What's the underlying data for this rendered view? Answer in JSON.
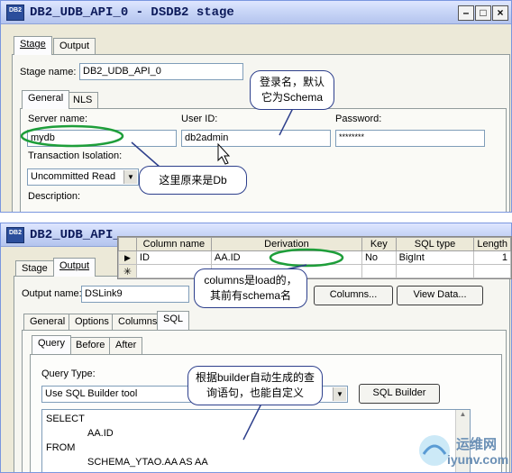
{
  "top_window": {
    "icon_text": "DB2",
    "title": "DB2_UDB_API_0 - DSDB2 stage",
    "tabs": [
      "Stage",
      "Output"
    ],
    "stage_name_label": "Stage name:",
    "stage_name_value": "DB2_UDB_API_0",
    "inner_tabs": [
      "General",
      "NLS"
    ],
    "server_name_label": "Server name:",
    "server_name_value": "mydb",
    "user_id_label": "User ID:",
    "user_id_value": "db2admin",
    "password_label": "Password:",
    "password_value": "********",
    "isolation_label": "Transaction Isolation:",
    "isolation_value": "Uncommitted Read",
    "description_label": "Description:"
  },
  "bottom_window": {
    "icon_text": "DB2",
    "title_visible": "DB2_UDB_API_",
    "tabs": [
      "Stage",
      "Output"
    ],
    "output_name_label": "Output name:",
    "output_name_value": "DSLink9",
    "columns_button": "Columns...",
    "view_data_button": "View Data...",
    "inner_tabs": [
      "General",
      "Options",
      "Columns",
      "SQL"
    ],
    "query_tabs": [
      "Query",
      "Before",
      "After"
    ],
    "query_type_label": "Query Type:",
    "query_type_value": "Use SQL Builder tool",
    "sql_builder_button": "SQL Builder",
    "sql_lines": [
      "SELECT",
      "AA.ID",
      "FROM",
      "SCHEMA_YTAO.AA AS AA"
    ]
  },
  "column_grid": {
    "headers": [
      "Column name",
      "Derivation",
      "Key",
      "SQL type",
      "Length"
    ],
    "rows": [
      {
        "marker": "▶",
        "cells": [
          "ID",
          "AA.ID",
          "No",
          "BigInt",
          "1"
        ]
      },
      {
        "marker": "✳",
        "cells": [
          "",
          "",
          "",
          "",
          ""
        ]
      }
    ]
  },
  "callouts": {
    "login": "登录名，默认它为Schema",
    "db": "这里原来是Db",
    "columns": "columns是load的，其前有schema名",
    "builder": "根据builder自动生成的查询语句，也能自定义"
  },
  "watermark": {
    "brand": "运维网",
    "domain": "iyunv.com"
  },
  "colors": {
    "annotation_ellipse": "#1e9e3a",
    "callout_border": "#2d3f8c",
    "window_bg": "#ece9d8"
  }
}
